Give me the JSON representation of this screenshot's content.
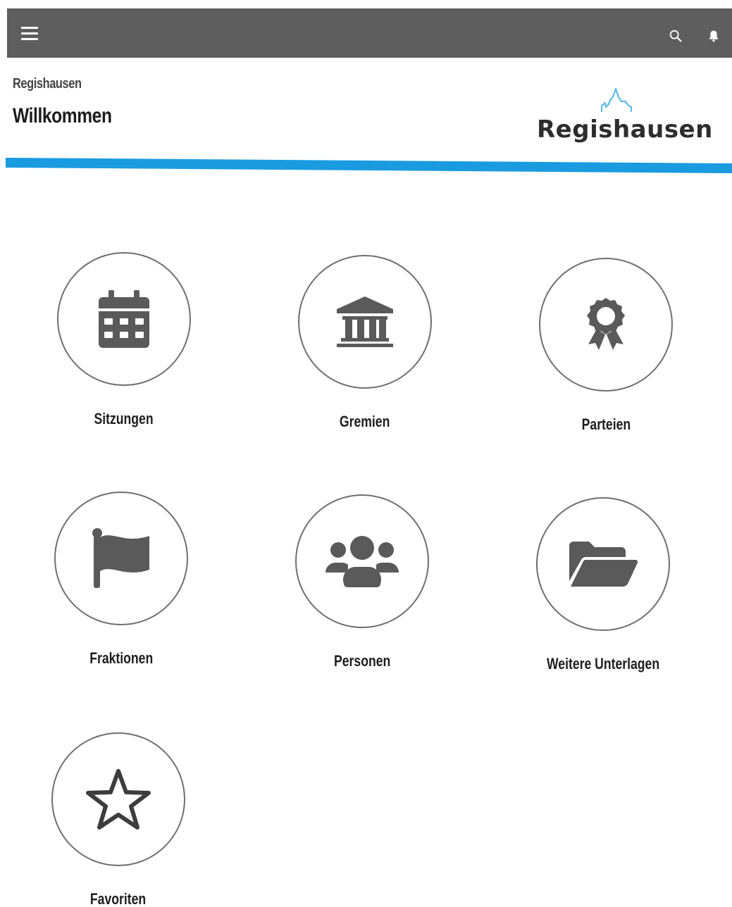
{
  "appbar": {
    "menu_icon": "hamburger-menu-icon",
    "search_icon": "search-icon",
    "notification_icon": "bell-icon",
    "background": "#5e5e5e"
  },
  "header": {
    "subtitle": "Regishausen",
    "title": "Willkommen",
    "logo_text": "Regishausen",
    "accent_color": "#1a9be0"
  },
  "tiles": [
    {
      "label": "Sitzungen",
      "icon": "calendar-icon"
    },
    {
      "label": "Gremien",
      "icon": "institution-icon"
    },
    {
      "label": "Parteien",
      "icon": "award-ribbon-icon"
    },
    {
      "label": "Fraktionen",
      "icon": "flag-icon"
    },
    {
      "label": "Personen",
      "icon": "people-group-icon"
    },
    {
      "label": "Weitere Unterlagen",
      "icon": "folder-open-icon"
    },
    {
      "label": "Favoriten",
      "icon": "star-outline-icon"
    }
  ]
}
